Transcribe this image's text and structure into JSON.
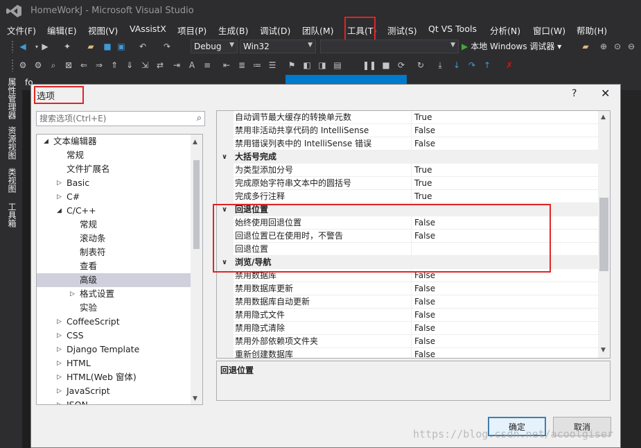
{
  "window": {
    "title": "HomeWorkJ - Microsoft Visual Studio"
  },
  "menu": [
    "文件(F)",
    "编辑(E)",
    "视图(V)",
    "VAssistX",
    "项目(P)",
    "生成(B)",
    "调试(D)",
    "团队(M)",
    "工具(T)",
    "测试(S)",
    "Qt VS Tools",
    "分析(N)",
    "窗口(W)",
    "帮助(H)"
  ],
  "toolbar": {
    "configuration": "Debug",
    "platform": "Win32",
    "startup": "",
    "run_label": "本地 Windows 调试器"
  },
  "side_tabs": [
    "属性管理器",
    "资源视图",
    "类视图",
    "工具箱"
  ],
  "doc_tabs": [
    "fo"
  ],
  "dialog": {
    "title": "选项",
    "help": "?",
    "close": "✕",
    "search_placeholder": "搜索选项(Ctrl+E)",
    "tree": [
      {
        "label": "文本编辑器",
        "level": 0,
        "arrow": "open"
      },
      {
        "label": "常规",
        "level": 1,
        "arrow": "none"
      },
      {
        "label": "文件扩展名",
        "level": 1,
        "arrow": "none"
      },
      {
        "label": "Basic",
        "level": 1,
        "arrow": "closed"
      },
      {
        "label": "C#",
        "level": 1,
        "arrow": "closed"
      },
      {
        "label": "C/C++",
        "level": 1,
        "arrow": "open"
      },
      {
        "label": "常规",
        "level": 2,
        "arrow": "none"
      },
      {
        "label": "滚动条",
        "level": 2,
        "arrow": "none"
      },
      {
        "label": "制表符",
        "level": 2,
        "arrow": "none"
      },
      {
        "label": "查看",
        "level": 2,
        "arrow": "none"
      },
      {
        "label": "高级",
        "level": 2,
        "arrow": "none",
        "selected": true
      },
      {
        "label": "格式设置",
        "level": 2,
        "arrow": "closed"
      },
      {
        "label": "实验",
        "level": 2,
        "arrow": "none"
      },
      {
        "label": "CoffeeScript",
        "level": 1,
        "arrow": "closed"
      },
      {
        "label": "CSS",
        "level": 1,
        "arrow": "closed"
      },
      {
        "label": "Django Template",
        "level": 1,
        "arrow": "closed"
      },
      {
        "label": "HTML",
        "level": 1,
        "arrow": "closed"
      },
      {
        "label": "HTML(Web 窗体)",
        "level": 1,
        "arrow": "closed"
      },
      {
        "label": "JavaScript",
        "level": 1,
        "arrow": "closed"
      },
      {
        "label": "JSON",
        "level": 1,
        "arrow": "closed"
      }
    ],
    "grid": [
      {
        "type": "item",
        "name": "自动调节最大缓存的转换单元数",
        "value": "True"
      },
      {
        "type": "item",
        "name": "禁用非活动共享代码的 IntelliSense",
        "value": "False"
      },
      {
        "type": "item",
        "name": "禁用错误列表中的 IntelliSense 错误",
        "value": "False"
      },
      {
        "type": "category",
        "name": "大括号完成"
      },
      {
        "type": "item",
        "name": "为类型添加分号",
        "value": "True"
      },
      {
        "type": "item",
        "name": "完成原始字符串文本中的圆括号",
        "value": "True"
      },
      {
        "type": "item",
        "name": "完成多行注释",
        "value": "True"
      },
      {
        "type": "category",
        "name": "回退位置"
      },
      {
        "type": "item",
        "name": "始终使用回退位置",
        "value": "False"
      },
      {
        "type": "item",
        "name": "回退位置已在使用时，不警告",
        "value": "False"
      },
      {
        "type": "item",
        "name": "回退位置",
        "value": ""
      },
      {
        "type": "category",
        "name": "浏览/导航"
      },
      {
        "type": "item",
        "name": "禁用数据库",
        "value": "False"
      },
      {
        "type": "item",
        "name": "禁用数据库更新",
        "value": "False"
      },
      {
        "type": "item",
        "name": "禁用数据库自动更新",
        "value": "False"
      },
      {
        "type": "item",
        "name": "禁用隐式文件",
        "value": "False"
      },
      {
        "type": "item",
        "name": "禁用隐式清除",
        "value": "False"
      },
      {
        "type": "item",
        "name": "禁用外部依赖项文件夹",
        "value": "False"
      },
      {
        "type": "item",
        "name": "重新创建数据库",
        "value": "False"
      }
    ],
    "description_title": "回退位置",
    "ok": "确定",
    "cancel": "取消"
  },
  "watermark": "https://blog.csdn.net/acoolgiser",
  "colors": {
    "accent": "#007acc",
    "highlight_box": "#e02424",
    "selection": "#cfd0dc"
  }
}
